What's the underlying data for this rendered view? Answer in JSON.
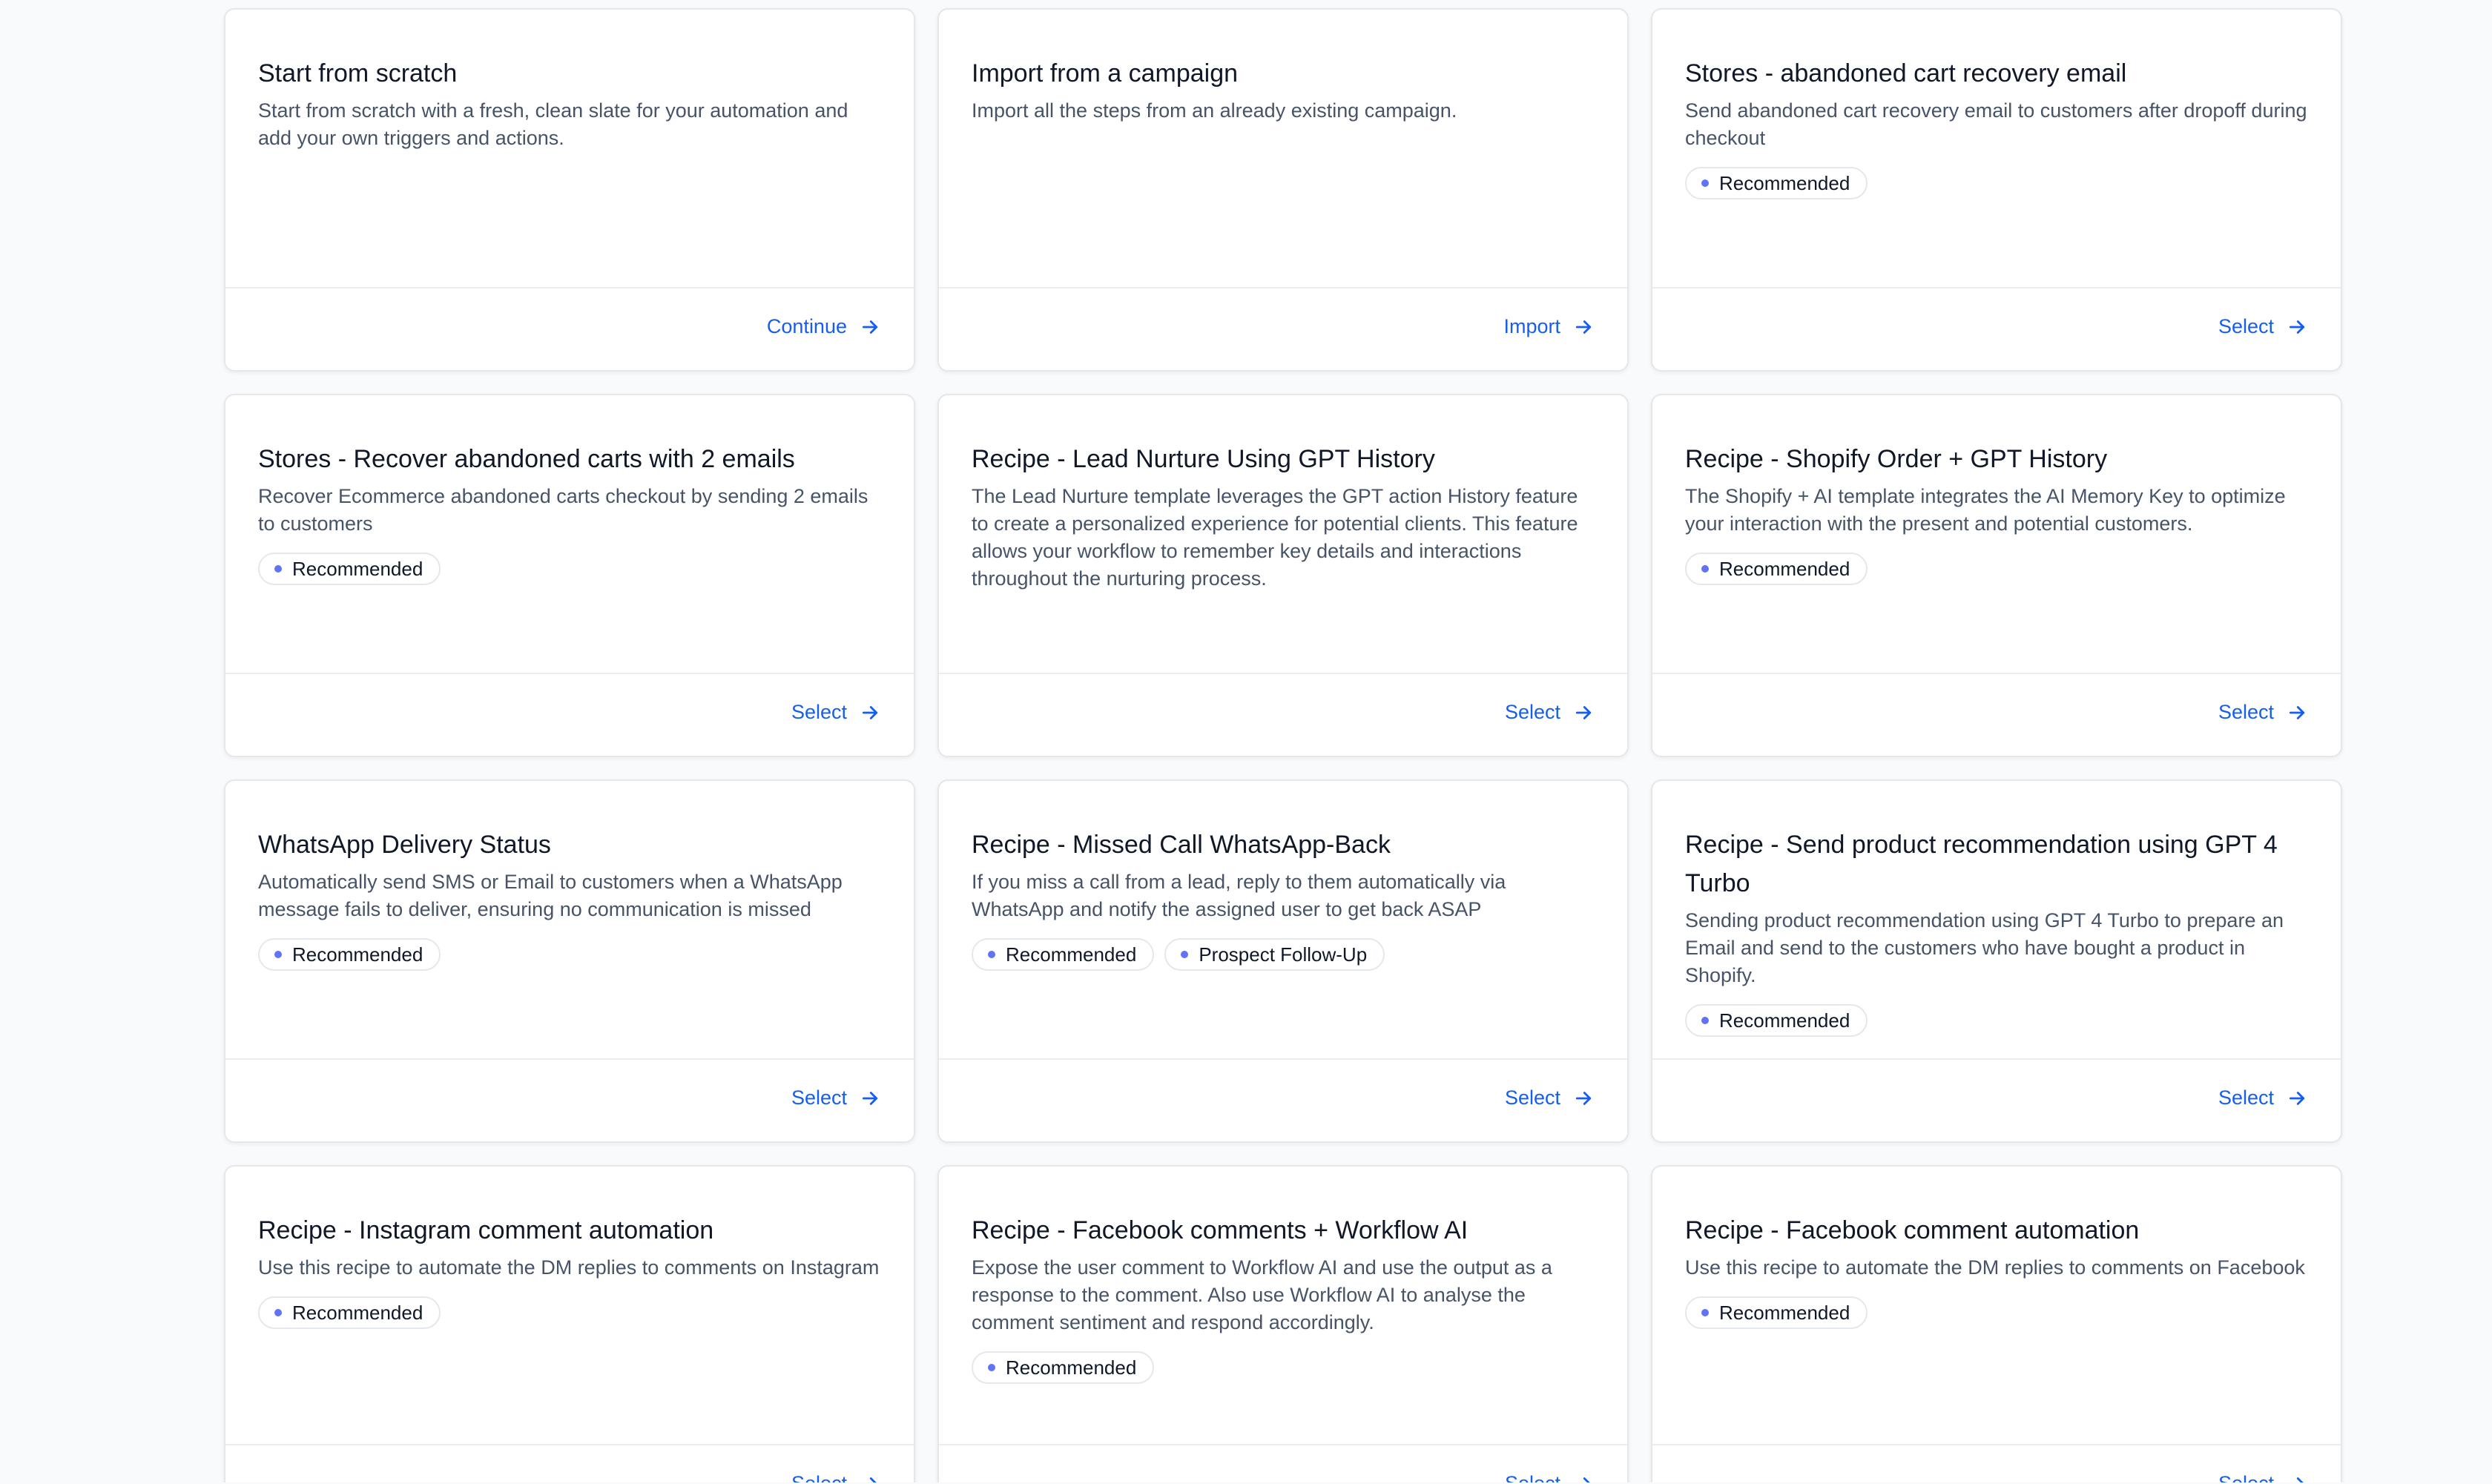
{
  "colors": {
    "accent": "#155eef",
    "tag_dot": "#6172f3",
    "page_background": "#f9fafb",
    "card_border": "#e5e7eb"
  },
  "icons": {
    "action_arrow": "arrow-right-icon",
    "tag_bullet": "dot-icon"
  },
  "templates": [
    {
      "title": "Start from scratch",
      "description": "Start from scratch with a fresh, clean slate for your automation and add your own triggers and actions.",
      "tags": [],
      "action_label": "Continue"
    },
    {
      "title": "Import from a campaign",
      "description": "Import all the steps from an already existing campaign.",
      "tags": [],
      "action_label": "Import"
    },
    {
      "title": "Stores - abandoned cart recovery email",
      "description": "Send abandoned cart recovery email to customers after dropoff during checkout",
      "tags": [
        "Recommended"
      ],
      "action_label": "Select"
    },
    {
      "title": "Stores - Recover abandoned carts with 2 emails",
      "description": "Recover Ecommerce abandoned carts checkout by sending 2 emails to customers",
      "tags": [
        "Recommended"
      ],
      "action_label": "Select"
    },
    {
      "title": "Recipe - Lead Nurture Using GPT History",
      "description": "The Lead Nurture template leverages the GPT action History feature to create a personalized experience for potential clients. This feature allows your workflow to remember key details and interactions throughout the nurturing process.",
      "tags": [],
      "action_label": "Select"
    },
    {
      "title": "Recipe - Shopify Order + GPT History",
      "description": "The Shopify + AI template integrates the AI Memory Key to optimize your interaction with the present and potential customers.",
      "tags": [
        "Recommended"
      ],
      "action_label": "Select"
    },
    {
      "title": "WhatsApp Delivery Status",
      "description": "Automatically send SMS or Email to customers when a WhatsApp message fails to deliver, ensuring no communication is missed",
      "tags": [
        "Recommended"
      ],
      "action_label": "Select"
    },
    {
      "title": "Recipe - Missed Call WhatsApp-Back",
      "description": "If you miss a call from a lead, reply to them automatically via WhatsApp and notify the assigned user to get back ASAP",
      "tags": [
        "Recommended",
        "Prospect Follow-Up"
      ],
      "action_label": "Select"
    },
    {
      "title": "Recipe - Send product recommendation using GPT 4 Turbo",
      "description": "Sending product recommendation using GPT 4 Turbo to prepare an Email and send to the customers who have bought a product in Shopify.",
      "tags": [
        "Recommended"
      ],
      "action_label": "Select"
    },
    {
      "title": "Recipe - Instagram comment automation",
      "description": "Use this recipe to automate the DM replies to comments on Instagram",
      "tags": [
        "Recommended"
      ],
      "action_label": "Select"
    },
    {
      "title": "Recipe - Facebook comments + Workflow AI",
      "description": "Expose the user comment to Workflow AI and use the output as a response to the comment. Also use Workflow AI to analyse the comment sentiment and respond accordingly.",
      "tags": [
        "Recommended"
      ],
      "action_label": "Select"
    },
    {
      "title": "Recipe - Facebook comment automation",
      "description": "Use this recipe to automate the DM replies to comments on Facebook",
      "tags": [
        "Recommended"
      ],
      "action_label": "Select"
    }
  ]
}
